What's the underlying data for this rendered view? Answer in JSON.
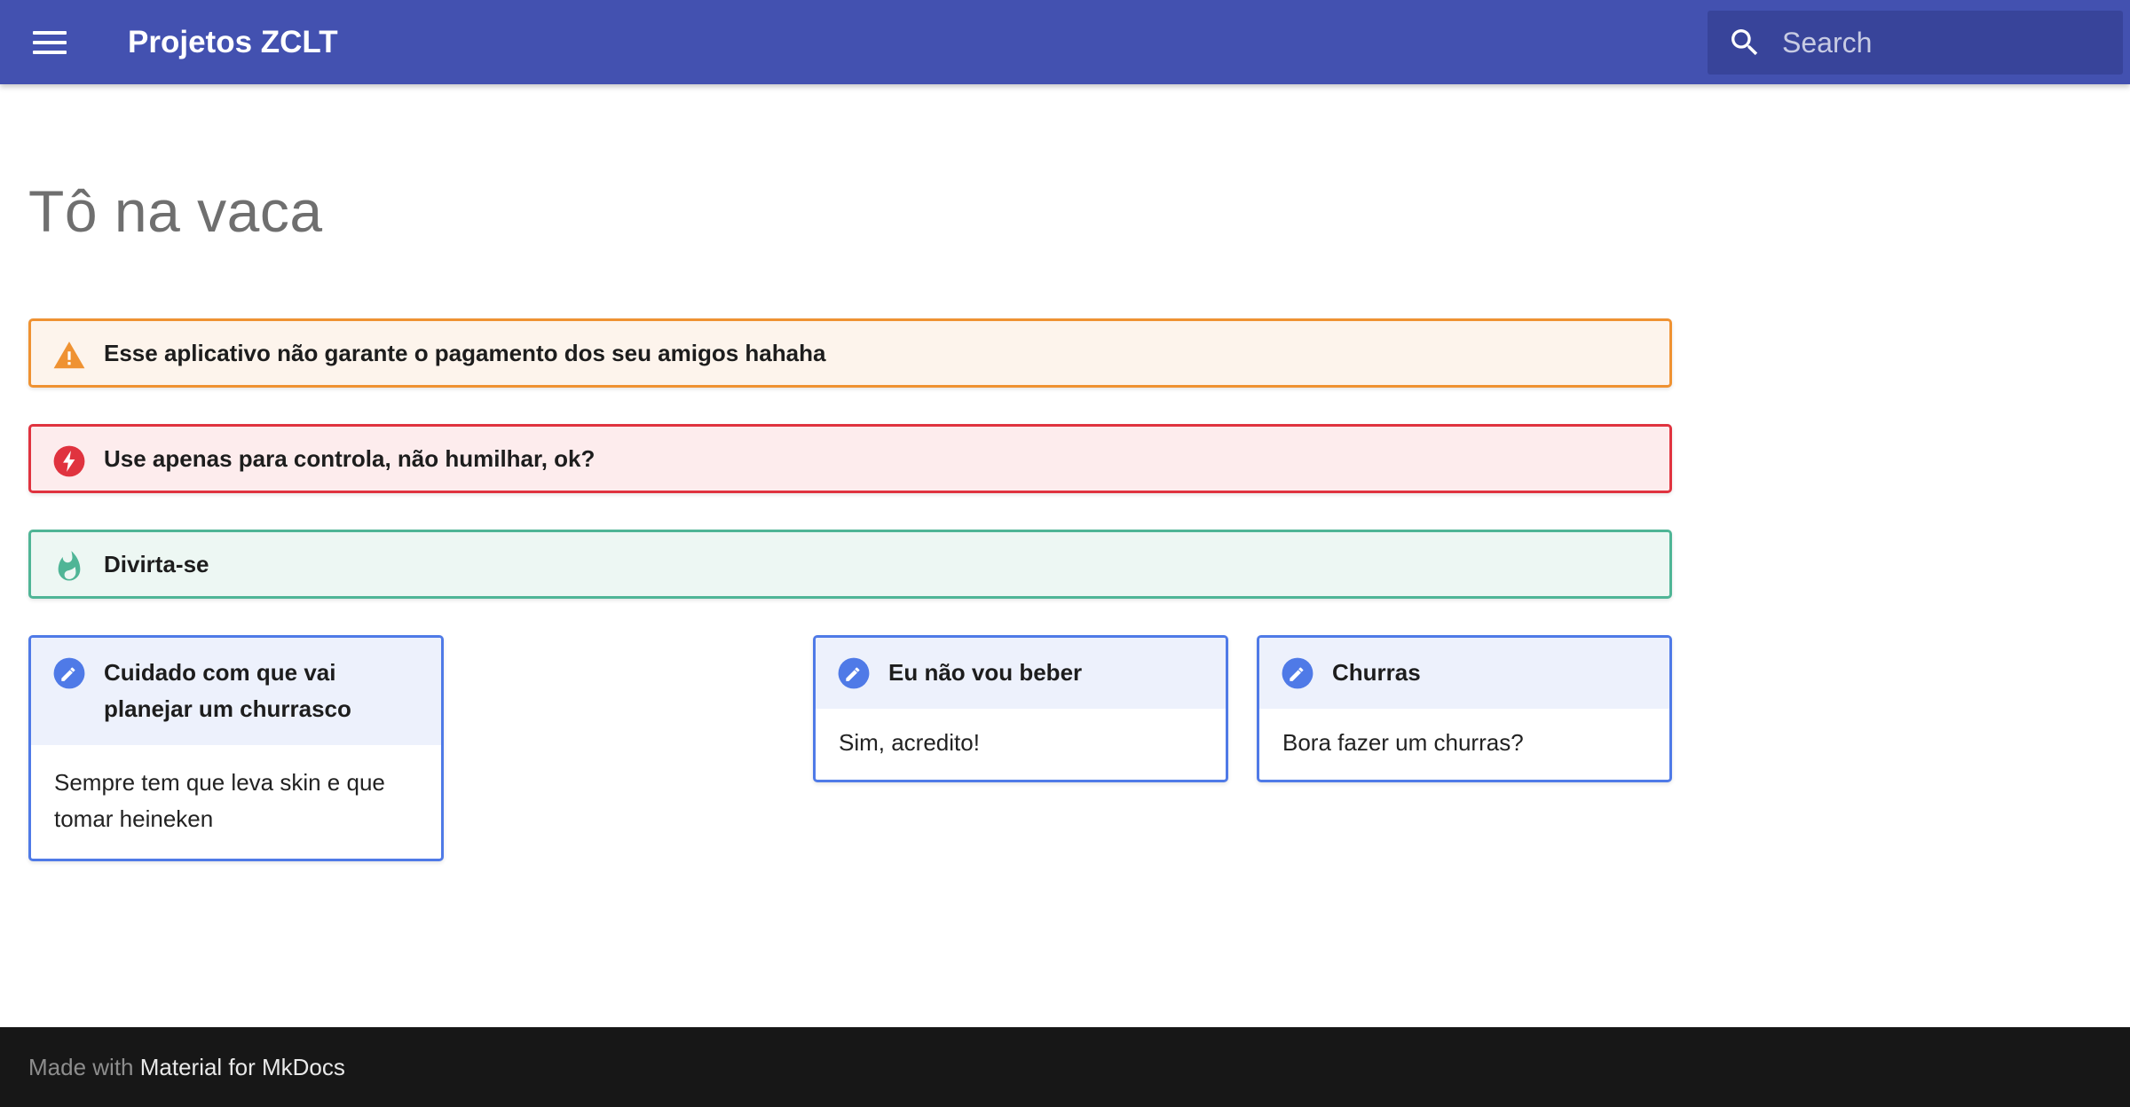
{
  "header": {
    "menu_icon": "hamburger-menu-icon",
    "site_title": "Projetos ZCLT",
    "search_placeholder": "Search",
    "search_icon": "magnifier-icon",
    "bg_color": "#4351b0"
  },
  "main": {
    "page_title": "Tô na vaca",
    "admonitions": [
      {
        "type": "warning",
        "icon": "warning-triangle-icon",
        "title": "Esse aplicativo não garante o pagamento dos seu amigos hahaha",
        "color": "#ef9232"
      },
      {
        "type": "danger",
        "icon": "lightning-bolt-icon",
        "title": "Use apenas para controla, não humilhar, ok?",
        "color": "#e0333f"
      },
      {
        "type": "tip",
        "icon": "flame-icon",
        "title": "Divirta-se",
        "color": "#4fb596"
      }
    ],
    "notes": [
      {
        "icon": "pencil-icon",
        "title": "Cuidado com que vai planejar um churrasco",
        "body": "Sempre tem que leva skin e que tomar heineken"
      },
      {
        "icon": "pencil-icon",
        "title": "Eu não vou beber",
        "body": "Sim, acredito!"
      },
      {
        "icon": "pencil-icon",
        "title": "Churras",
        "body": "Bora fazer um churras?"
      }
    ],
    "note_color": "#4f7ae7"
  },
  "footer": {
    "prefix": "Made with ",
    "link_text": "Material for MkDocs"
  }
}
